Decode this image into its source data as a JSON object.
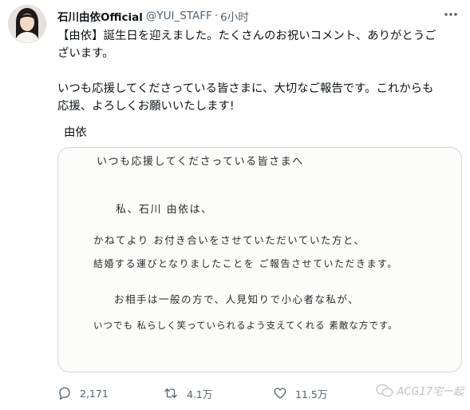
{
  "tweet": {
    "author_name": "石川由依Official",
    "handle": "@YUI_STAFF",
    "separator": "·",
    "time": "6小时",
    "text_line1": "【由依】誕生日を迎えました。たくさんのお祝いコメント、ありがとうご",
    "text_line2": "ざいます。",
    "text_line3": "いつも応援してくださっている皆さまに、大切なご報告です。これからも",
    "text_line4": "応援、よろしくお願いいたします!",
    "signature": "由依"
  },
  "letter": {
    "line1": "いつも応援してくださっている皆さまへ",
    "line2": "私、石川 由依は、",
    "line3": "かねてより お付き合いをさせていただいていた方と、",
    "line4": "結婚する運びとなりましたことを ご報告させていただきます。",
    "line5": "お相手は一般の方で、人見知りで小心者な私が、",
    "line6": "いつでも 私らしく笑っていられるよう支えてくれる 素敵な方です。"
  },
  "actions": {
    "replies": "2,171",
    "retweets": "4.1万",
    "likes": "11.5万"
  },
  "watermark": {
    "text": "ACG17宅一起"
  },
  "colors": {
    "secondary_text": "#536471",
    "border": "#cfd9de",
    "text": "#0f1419"
  }
}
